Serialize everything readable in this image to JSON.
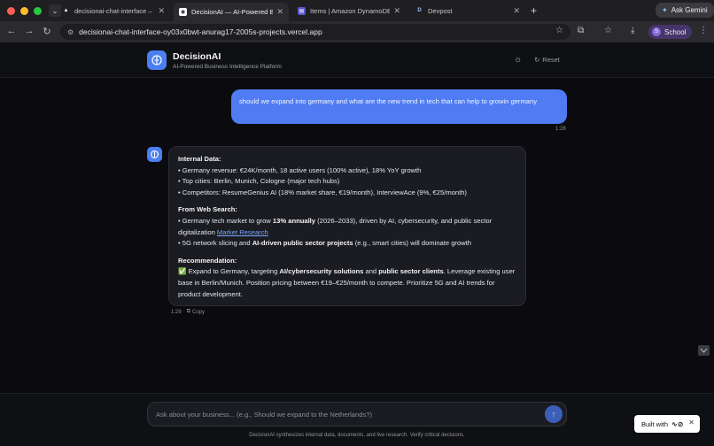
{
  "browser": {
    "tabs": [
      {
        "label": "decisionai-chat-interface – D",
        "favicon": "triangle-icon",
        "active": false
      },
      {
        "label": "DecisionAI — AI-Powered Bu",
        "favicon": "app-icon",
        "active": true
      },
      {
        "label": "Items | Amazon DynamoDB M",
        "favicon": "dynamodb-icon",
        "active": false
      },
      {
        "label": "Devpost",
        "favicon": "devpost-icon",
        "active": false
      }
    ],
    "ask_gemini": "Ask Gemini",
    "url": "decisionai-chat-interface-oy03x0bwt-anurag17-2005s-projects.vercel.app",
    "profile_label": "School",
    "profile_initial": "S"
  },
  "app": {
    "title": "DecisionAI",
    "subtitle": "AI-Powered Business Intelligence Platform",
    "reset_label": "Reset"
  },
  "chat": {
    "user_message": "should we expand into germany and what are the new trend in tech that can help to growin germany",
    "user_time": "1:28",
    "bot": {
      "internal_heading": "Internal Data:",
      "internal_lines": [
        "• Germany revenue: €24K/month, 18 active users (100% active), 18% YoY growth",
        "• Top cities: Berlin, Munich, Cologne (major tech hubs)",
        "• Competitors: ResumeGenius AI (18% market share, €19/month), InterviewAce (9%, €25/month)"
      ],
      "web_heading": "From Web Search:",
      "web_line1_pre": "• Germany tech market to grow ",
      "web_line1_bold": "13% annually",
      "web_line1_post": " (2026–2033), driven by AI, cybersecurity, and public sector digitalization ",
      "web_link": "Market Research",
      "web_line2_pre": "• 5G network slicing and ",
      "web_line2_bold": "AI-driven public sector projects",
      "web_line2_post": " (e.g., smart cities) will dominate growth",
      "rec_heading": "Recommendation:",
      "rec_pre": "✅ Expand to Germany, targeting ",
      "rec_bold1": "AI/cybersecurity solutions",
      "rec_mid": " and ",
      "rec_bold2": "public sector clients",
      "rec_post": ". Leverage existing user base in Berlin/Munich. Position pricing between €19–€25/month to compete. Prioritize 5G and AI trends for product development."
    },
    "bot_time": "1:29",
    "copy_label": "Copy"
  },
  "composer": {
    "placeholder": "Ask about your business... (e.g., Should we expand to the Netherlands?)",
    "value": ""
  },
  "disclaimer": "DecisionAI synthesizes internal data, documents, and live research. Verify critical decisions.",
  "badge": {
    "built_with": "Built with"
  },
  "colors": {
    "accent": "#4f7cf2",
    "background": "#0b0b0f",
    "bubble": "#1b1c21",
    "link": "#7aa6ff"
  }
}
